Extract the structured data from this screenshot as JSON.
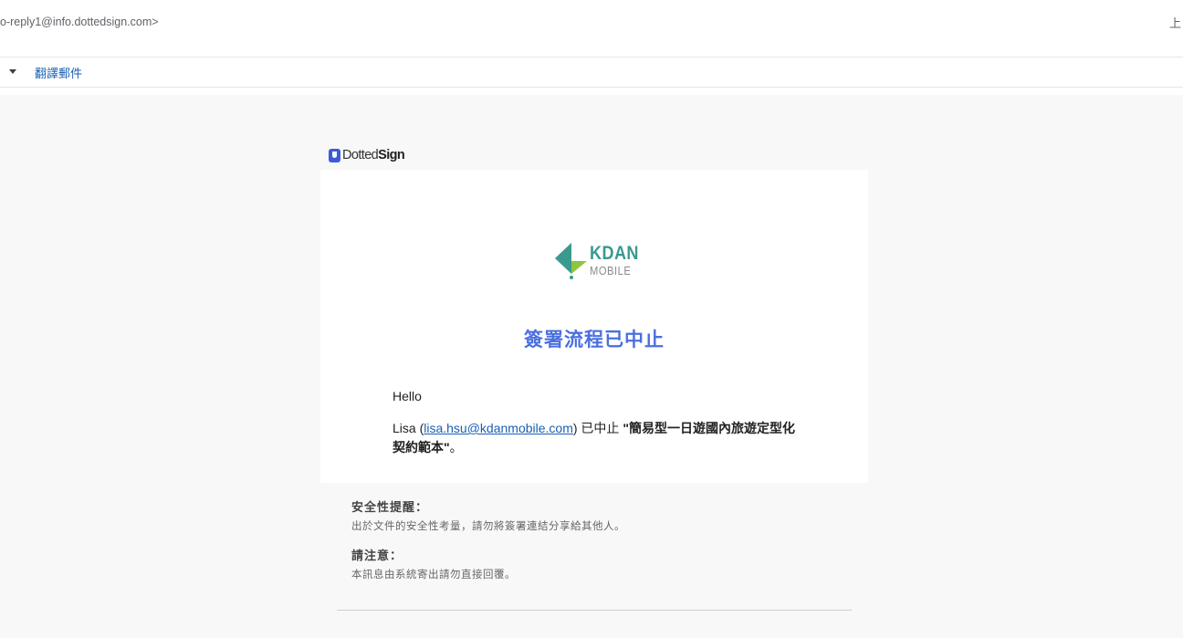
{
  "header": {
    "sender_address": "o-reply1@info.dottedsign.com>",
    "right_label": "上"
  },
  "toolbar": {
    "translate_label": "翻譯郵件"
  },
  "email": {
    "brand_logo": {
      "prefix": "Dotted",
      "suffix": "Sign"
    },
    "company_logo": {
      "name": "KDAN",
      "subtitle": "MOBILE"
    },
    "title": "簽署流程已中止",
    "greeting": "Hello",
    "message": {
      "name": "Lisa",
      "open_paren": " (",
      "email": "lisa.hsu@kdanmobile.com",
      "action": ") 已中止 ",
      "document": "\"簡易型一日遊國內旅遊定型化契約範本\"",
      "end": "。"
    },
    "security": {
      "heading": "安全性提醒：",
      "text": "出於文件的安全性考量，請勿將簽署連結分享給其他人。"
    },
    "note": {
      "heading": "請注意：",
      "text": "本訊息由系統寄出請勿直接回覆。"
    }
  },
  "colors": {
    "accent": "#4b6fe0",
    "kdan_teal": "#3a9a8e",
    "kdan_green": "#8dc63f",
    "link": "#1a5fb4",
    "background": "#f8f8f8"
  }
}
